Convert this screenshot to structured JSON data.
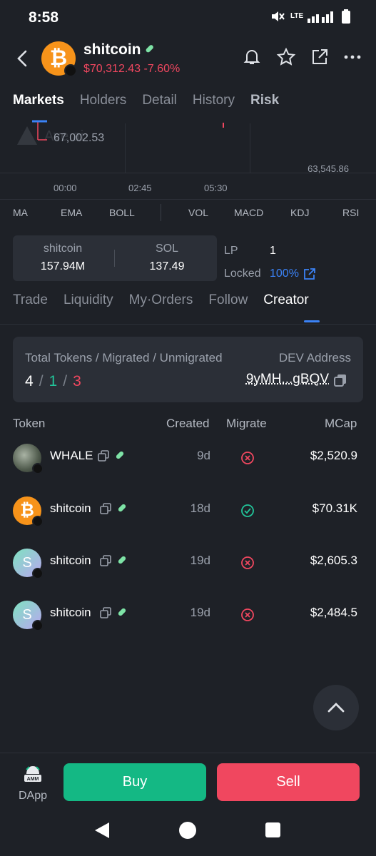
{
  "status": {
    "time": "8:58",
    "network": "LTE"
  },
  "header": {
    "coin_name": "shitcoin",
    "price_change": "$70,312.43 -7.60%",
    "icons": [
      "back-icon",
      "bell-icon",
      "star-icon",
      "share-icon",
      "more-icon"
    ]
  },
  "main_tabs": [
    {
      "label": "Markets",
      "active": true
    },
    {
      "label": "Holders",
      "active": false
    },
    {
      "label": "Detail",
      "active": false
    },
    {
      "label": "History",
      "active": false
    },
    {
      "label": "Risk",
      "active": false
    }
  ],
  "chart": {
    "high_label": "67,002.53",
    "low_label": "63,545.86",
    "times": [
      "00:00",
      "02:45",
      "05:30"
    ]
  },
  "indicators": [
    "MA",
    "EMA",
    "BOLL",
    "VOL",
    "MACD",
    "KDJ",
    "RSI"
  ],
  "pool": {
    "left_label": "shitcoin",
    "left_value": "157.94M",
    "right_label": "SOL",
    "right_value": "137.49",
    "lp_label": "LP",
    "lp_value": "1",
    "locked_label": "Locked",
    "locked_value": "100%"
  },
  "sub_tabs": [
    {
      "label": "Trade",
      "active": false
    },
    {
      "label": "Liquidity",
      "active": false
    },
    {
      "label": "My·Orders",
      "active": false
    },
    {
      "label": "Follow",
      "active": false
    },
    {
      "label": "Creator",
      "active": true
    }
  ],
  "creator": {
    "summary_label": "Total Tokens / Migrated / Unmigrated",
    "total": "4",
    "sep": "/",
    "migrated": "1",
    "unmigrated": "3",
    "dev_label": "DEV Address",
    "dev_address": "9yMH...gBQV"
  },
  "table": {
    "headers": {
      "token": "Token",
      "created": "Created",
      "migrate": "Migrate",
      "mcap": "MCap"
    },
    "rows": [
      {
        "name": "WHALE",
        "created": "9d",
        "migrated": false,
        "mcap": "$2,520.9",
        "avatar": "whale-image",
        "avatar_letter": ""
      },
      {
        "name": "shitcoin",
        "created": "18d",
        "migrated": true,
        "mcap": "$70.31K",
        "avatar": "bitcoin-logo",
        "avatar_letter": "₿"
      },
      {
        "name": "shitcoin",
        "created": "19d",
        "migrated": false,
        "mcap": "$2,605.3",
        "avatar": "letter-avatar",
        "avatar_letter": "S"
      },
      {
        "name": "shitcoin",
        "created": "19d",
        "migrated": false,
        "mcap": "$2,484.5",
        "avatar": "letter-avatar",
        "avatar_letter": "S"
      }
    ]
  },
  "bottom": {
    "dapp_label": "DApp",
    "dapp_badge": "AMM",
    "buy_label": "Buy",
    "sell_label": "Sell"
  },
  "colors": {
    "green": "#14b884",
    "red": "#f0475f",
    "blue": "#3b82f6",
    "bg": "#1e2127"
  }
}
